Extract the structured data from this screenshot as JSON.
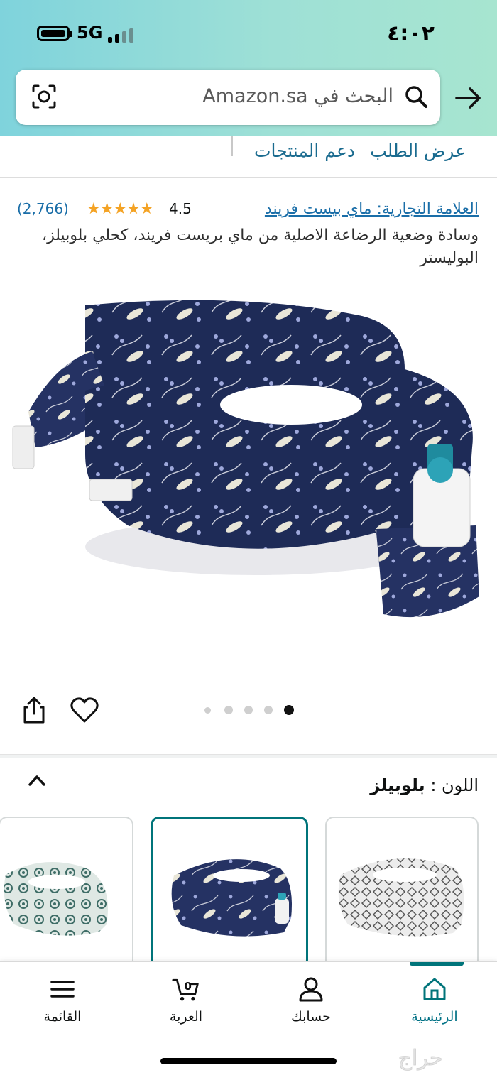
{
  "status_bar": {
    "time": "٤:٠٢",
    "network": "5G"
  },
  "search": {
    "placeholder": "البحث في Amazon.sa"
  },
  "subnav": {
    "links": [
      "عرض الطلب",
      "دعم المنتجات"
    ]
  },
  "product": {
    "brand": "العلامة التجارية: ماي بيست فريند",
    "rating": "4.5",
    "stars": "★★★★★",
    "review_count": "(2,766)",
    "title": "وسادة وضعية الرضاعة الاصلية من ماي بريست فريند، كحلي بلوبيلز، البوليستر"
  },
  "gallery": {
    "dots": 5,
    "active_dot": 5
  },
  "color_selector": {
    "label": "اللون :",
    "value": "بلوبيلز"
  },
  "tabbar": {
    "tabs": [
      {
        "label": "الرئيسية",
        "icon": "home-icon",
        "active": true
      },
      {
        "label": "حسابك",
        "icon": "account-icon",
        "active": false
      },
      {
        "label": "العربة",
        "icon": "cart-icon",
        "active": false,
        "badge": "0"
      },
      {
        "label": "القائمة",
        "icon": "menu-icon",
        "active": false
      }
    ]
  },
  "watermark": {
    "text": "حراج"
  },
  "colors": {
    "accent": "#00747a",
    "link": "#1a6ea8",
    "star": "#f4a325",
    "header": "#8fdad8"
  }
}
